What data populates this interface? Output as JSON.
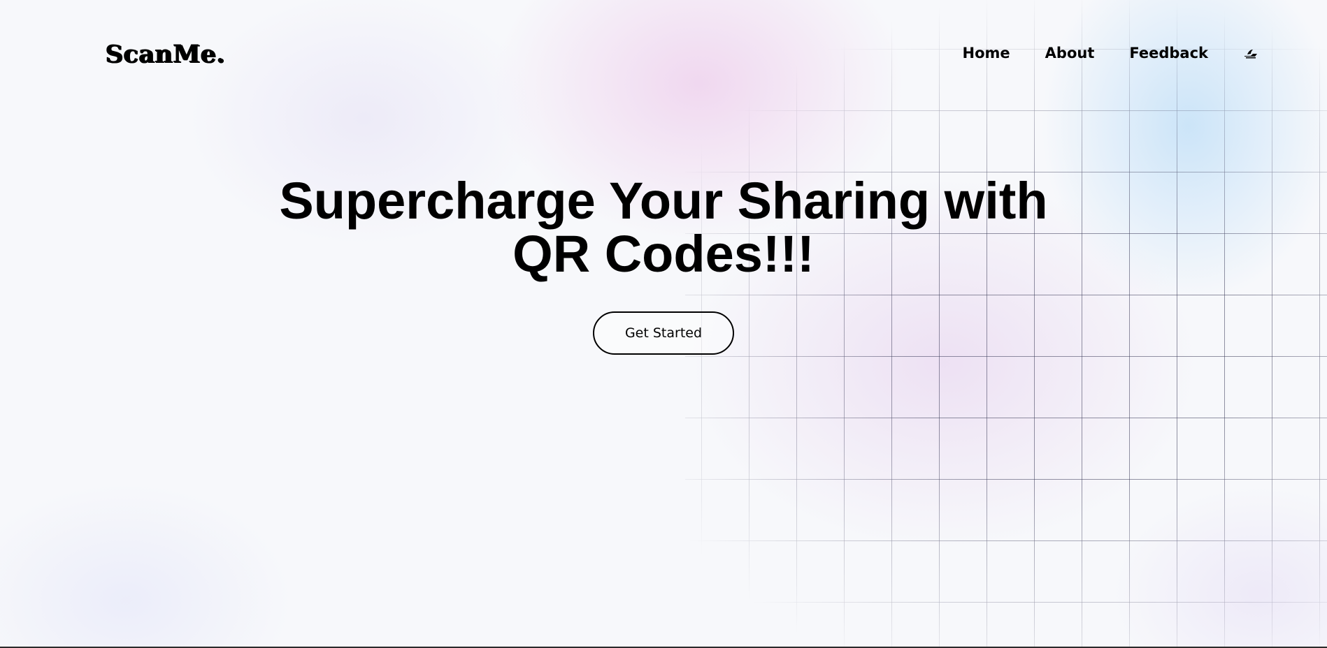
{
  "brand": {
    "logo_text": "ScanMe."
  },
  "nav": {
    "items": [
      {
        "label": "Home"
      },
      {
        "label": "About"
      },
      {
        "label": "Feedback"
      }
    ],
    "theme_toggle_icon": "theme-toggle-icon"
  },
  "hero": {
    "title_line1": "Supercharge Your Sharing with",
    "title_line2": "QR Codes!!!",
    "cta_label": "Get Started"
  },
  "colors": {
    "text": "#000000",
    "background": "#f7f8fb",
    "accent_pink": "#eecdec",
    "accent_blue": "#c4e1f8"
  }
}
